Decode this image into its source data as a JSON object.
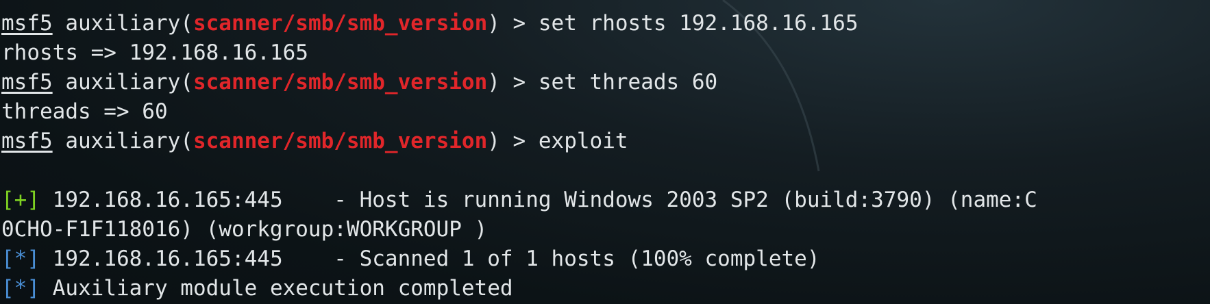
{
  "colors": {
    "background": "#0d1418",
    "text": "#e2e6e8",
    "module": "#e1262a",
    "success_tag": "#7fd322",
    "info_tag": "#4a8fd6"
  },
  "lines": [
    {
      "prompt": "msf5",
      "pre": " auxiliary(",
      "module": "scanner/smb/smb_version",
      "post": ") > set rhosts 192.168.16.165"
    },
    {
      "text": "rhosts => 192.168.16.165"
    },
    {
      "prompt": "msf5",
      "pre": " auxiliary(",
      "module": "scanner/smb/smb_version",
      "post": ") > set threads 60"
    },
    {
      "text": "threads => 60"
    },
    {
      "prompt": "msf5",
      "pre": " auxiliary(",
      "module": "scanner/smb/smb_version",
      "post": ") > exploit"
    },
    {
      "text": ""
    },
    {
      "tag": "[+]",
      "tag_type": "good",
      "text": " 192.168.16.165:445    - Host is running Windows 2003 SP2 (build:3790) (name:C"
    },
    {
      "text": "0CHO-F1F118016) (workgroup:WORKGROUP )"
    },
    {
      "tag": "[*]",
      "tag_type": "info",
      "text": " 192.168.16.165:445    - Scanned 1 of 1 hosts (100% complete)"
    },
    {
      "tag": "[*]",
      "tag_type": "info",
      "text": " Auxiliary module execution completed"
    }
  ]
}
